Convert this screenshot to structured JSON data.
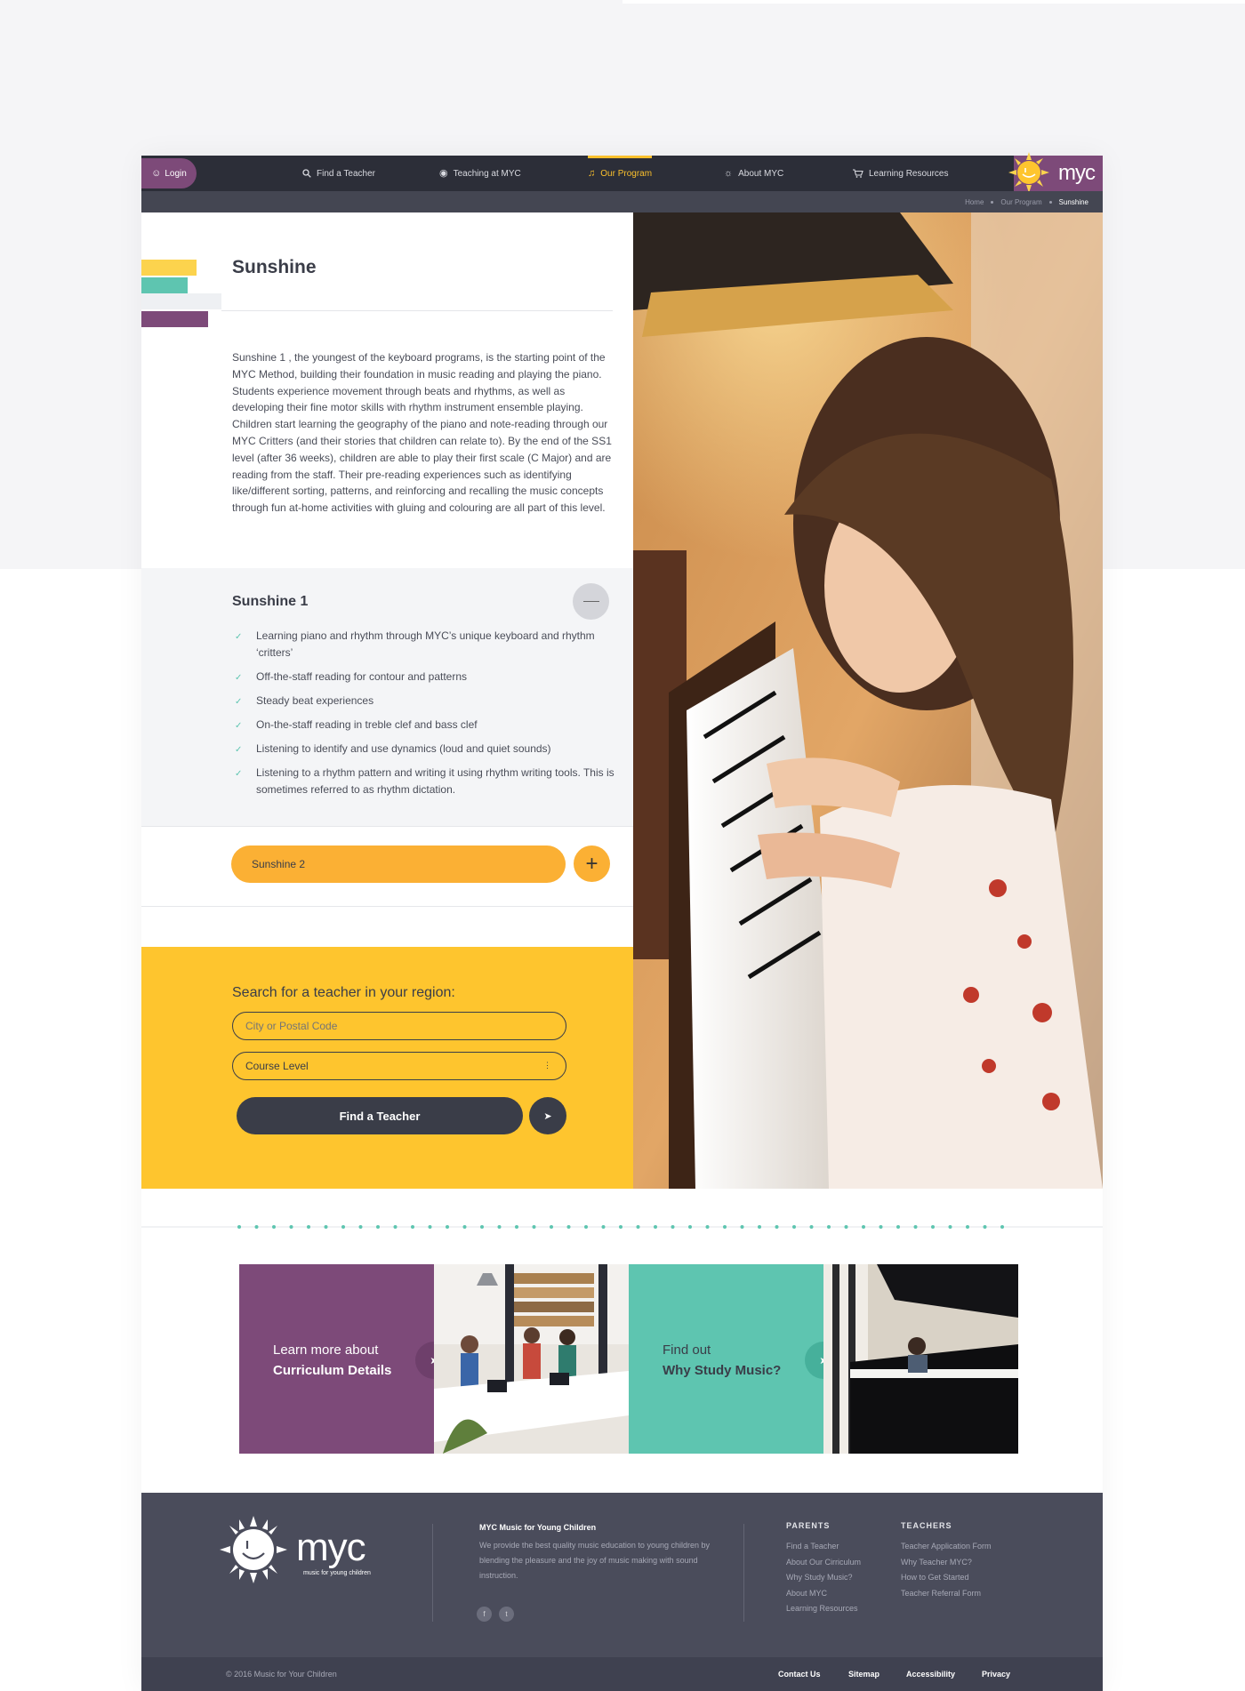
{
  "nav": {
    "login": "Login",
    "items": [
      {
        "label": "Find a Teacher",
        "icon": "search-icon"
      },
      {
        "label": "Teaching at MYC",
        "icon": "apple-icon"
      },
      {
        "label": "Our Program",
        "icon": "music-note-icon",
        "active": true
      },
      {
        "label": "About MYC",
        "icon": "sun-icon"
      },
      {
        "label": "Learning Resources",
        "icon": "cart-icon"
      }
    ],
    "logo_text": "myc"
  },
  "breadcrumb": [
    "Home",
    "Our Program",
    "Sunshine"
  ],
  "page": {
    "title": "Sunshine",
    "description": "Sunshine 1 , the youngest of the keyboard programs, is the starting point of the MYC Method, building their foundation in music reading and playing the piano.  Students experience movement through beats and rhythms, as well as developing their fine motor skills with rhythm instrument ensemble playing.  Children start learning the geography of the piano and note-reading through our MYC Critters (and their stories that children can relate to).  By the end of the SS1 level (after 36 weeks), children are able to play their first scale (C Major) and are reading from the staff.  Their pre-reading experiences such as identifying like/different sorting, patterns, and reinforcing and recalling the music concepts through fun at-home activities with gluing and colouring are all part of this level."
  },
  "accordion": [
    {
      "title": "Sunshine 1",
      "expanded": true,
      "items": [
        "Learning piano and rhythm through MYC’s unique keyboard and rhythm ‘critters’",
        "Off-the-staff reading for contour and patterns",
        "Steady beat experiences",
        "On-the-staff reading in treble clef and bass clef",
        "Listening to identify and use dynamics (loud and quiet sounds)",
        "Listening to a rhythm pattern and writing it using rhythm writing tools. This is sometimes referred to as rhythm dictation."
      ]
    },
    {
      "title": "Sunshine 2",
      "expanded": false
    }
  ],
  "search": {
    "heading": "Search for a teacher in your region:",
    "city_placeholder": "City or Postal Code",
    "course_level": "Course Level",
    "button": "Find a Teacher"
  },
  "promos": [
    {
      "line1": "Learn more about",
      "line2": "Curriculum Details"
    },
    {
      "line1": "Find out",
      "line2": "Why Study Music?"
    }
  ],
  "footer": {
    "logo_text": "myc",
    "logo_tagline": "music for young children",
    "about_title": "MYC Music for Young Children",
    "about_text": "We provide the best quality music education to young children by blending the pleasure and the joy of music making with sound instruction.",
    "social": [
      "f",
      "t"
    ],
    "parents_title": "PARENTS",
    "parents": [
      "Find a Teacher",
      "About Our Cirriculum",
      "Why Study Music?",
      "About MYC",
      "Learning Resources"
    ],
    "teachers_title": "TEACHERS",
    "teachers": [
      "Teacher Application Form",
      "Why Teacher MYC?",
      "How to Get Started",
      "Teacher Referral Form"
    ],
    "copyright": "© 2016 Music for Your Children",
    "bottom_links": [
      "Contact Us",
      "Sitemap",
      "Accessibility",
      "Privacy"
    ]
  },
  "colors": {
    "purple": "#7d4a79",
    "yellow": "#fec52e",
    "orange": "#fbb034",
    "teal": "#5ec5b0",
    "dark": "#2c2e38"
  }
}
